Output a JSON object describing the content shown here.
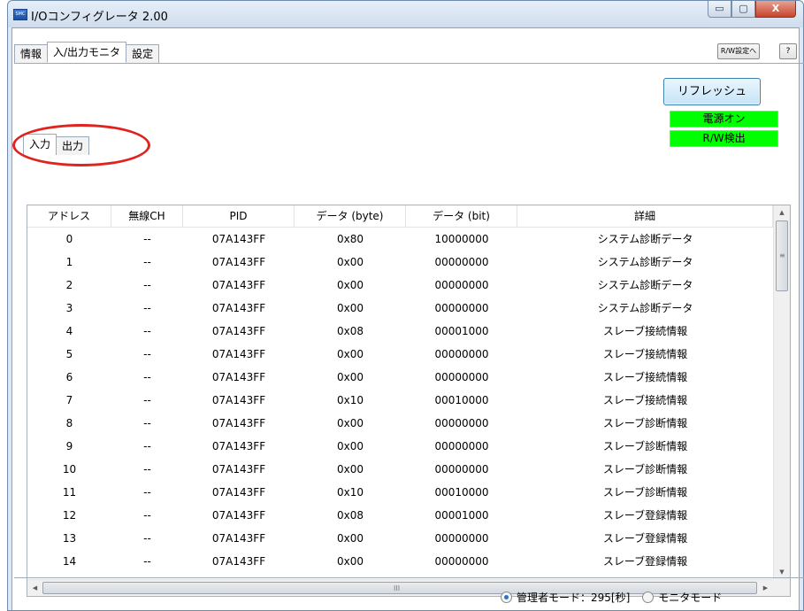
{
  "window": {
    "title": "I/Oコンフィグレータ 2.00",
    "minimize_glyph": "▭",
    "maximize_glyph": "▢",
    "close_glyph": "X"
  },
  "main_tabs": [
    {
      "label": "情報",
      "active": false
    },
    {
      "label": "入/出力モニタ",
      "active": true
    },
    {
      "label": "設定",
      "active": false
    }
  ],
  "toolbar": {
    "rw_settings_label": "R/W設定へ",
    "help_label": "?"
  },
  "refresh_label": "リフレッシュ",
  "status": {
    "power_label": "電源オン",
    "rw_detect_label": "R/W検出",
    "color": "#00ff00"
  },
  "sub_tabs": [
    {
      "label": "入力",
      "active": true
    },
    {
      "label": "出力",
      "active": false
    }
  ],
  "table": {
    "columns": [
      "アドレス",
      "無線CH",
      "PID",
      "データ (byte)",
      "データ (bit)",
      "詳細"
    ],
    "rows": [
      [
        "0",
        "--",
        "07A143FF",
        "0x80",
        "10000000",
        "システム診断データ"
      ],
      [
        "1",
        "--",
        "07A143FF",
        "0x00",
        "00000000",
        "システム診断データ"
      ],
      [
        "2",
        "--",
        "07A143FF",
        "0x00",
        "00000000",
        "システム診断データ"
      ],
      [
        "3",
        "--",
        "07A143FF",
        "0x00",
        "00000000",
        "システム診断データ"
      ],
      [
        "4",
        "--",
        "07A143FF",
        "0x08",
        "00001000",
        "スレーブ接続情報"
      ],
      [
        "5",
        "--",
        "07A143FF",
        "0x00",
        "00000000",
        "スレーブ接続情報"
      ],
      [
        "6",
        "--",
        "07A143FF",
        "0x00",
        "00000000",
        "スレーブ接続情報"
      ],
      [
        "7",
        "--",
        "07A143FF",
        "0x10",
        "00010000",
        "スレーブ接続情報"
      ],
      [
        "8",
        "--",
        "07A143FF",
        "0x00",
        "00000000",
        "スレーブ診断情報"
      ],
      [
        "9",
        "--",
        "07A143FF",
        "0x00",
        "00000000",
        "スレーブ診断情報"
      ],
      [
        "10",
        "--",
        "07A143FF",
        "0x00",
        "00000000",
        "スレーブ診断情報"
      ],
      [
        "11",
        "--",
        "07A143FF",
        "0x10",
        "00010000",
        "スレーブ診断情報"
      ],
      [
        "12",
        "--",
        "07A143FF",
        "0x08",
        "00001000",
        "スレーブ登録情報"
      ],
      [
        "13",
        "--",
        "07A143FF",
        "0x00",
        "00000000",
        "スレーブ登録情報"
      ],
      [
        "14",
        "--",
        "07A143FF",
        "0x00",
        "00000000",
        "スレーブ登録情報"
      ]
    ]
  },
  "scroll": {
    "up_glyph": "▲",
    "down_glyph": "▼",
    "left_glyph": "◀",
    "right_glyph": "▶",
    "v_grip": "≡",
    "h_grip": "III"
  },
  "modes": [
    {
      "label": "管理者モード：295[秒]",
      "checked": true
    },
    {
      "label": "モニタモード",
      "checked": false
    }
  ],
  "annotation": {
    "color": "#e0231e",
    "shape": "ellipse around input/output sub-tabs"
  },
  "icons": {
    "app": "smc-app-icon",
    "minimize": "minimize-icon",
    "maximize": "maximize-icon",
    "close": "close-icon"
  }
}
